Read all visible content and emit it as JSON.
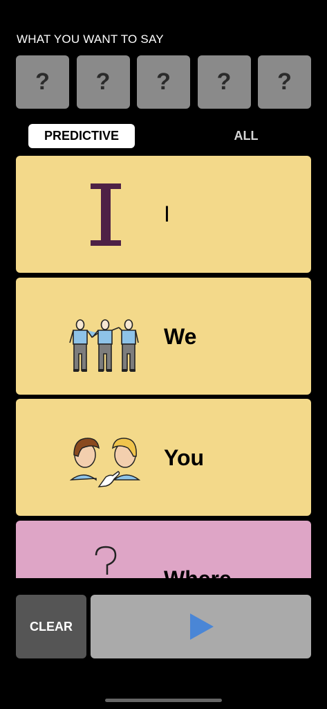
{
  "header": {
    "title": "WHAT YOU WANT TO SAY"
  },
  "slots": [
    "?",
    "?",
    "?",
    "?",
    "?"
  ],
  "tabs": {
    "predictive": "PREDICTIVE",
    "all": "ALL"
  },
  "cards": [
    {
      "label": "I",
      "symbol": "letter-i-icon",
      "color": "#f3d98a"
    },
    {
      "label": "We",
      "symbol": "three-people-icon",
      "color": "#f3d98a"
    },
    {
      "label": "You",
      "symbol": "two-people-talking-icon",
      "color": "#f3d98a"
    },
    {
      "label": "Where",
      "symbol": "question-mark-icon",
      "color": "#dea5c6"
    }
  ],
  "bottom": {
    "clear_label": "CLEAR",
    "speak_icon": "play-icon",
    "speak_icon_color": "#4a86d6"
  }
}
